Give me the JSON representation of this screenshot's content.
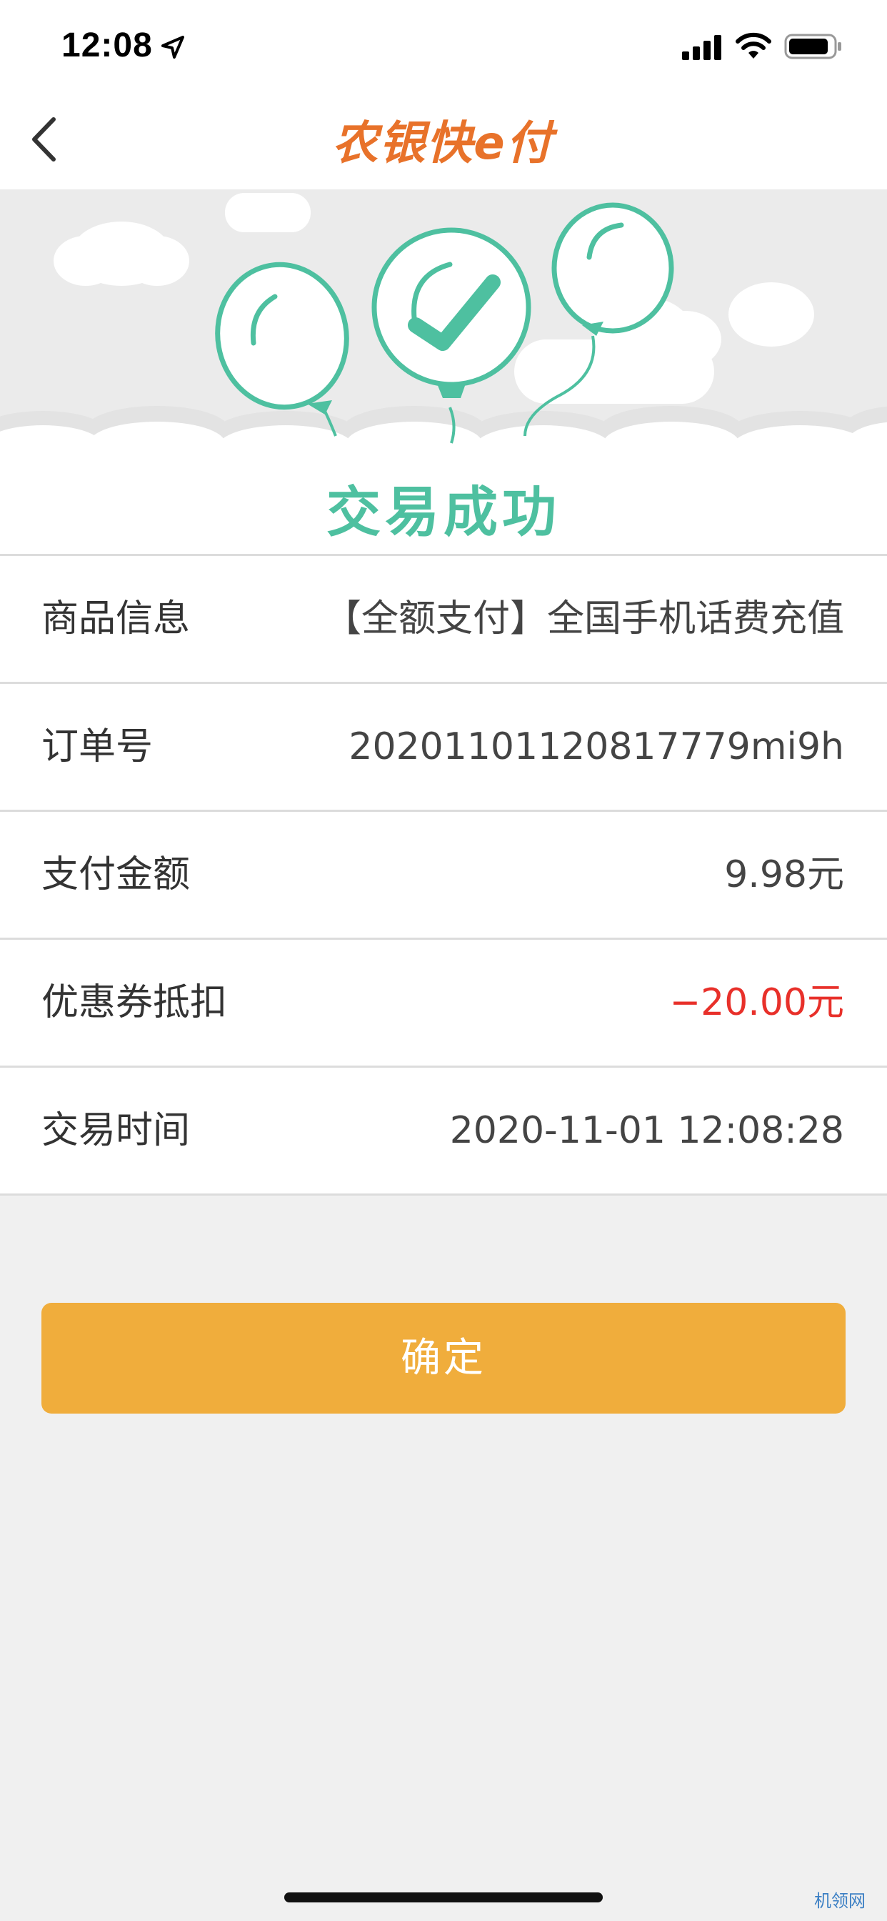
{
  "status_bar": {
    "time": "12:08",
    "icons": [
      "location-arrow-icon",
      "cellular-signal-icon",
      "wifi-icon",
      "battery-icon"
    ]
  },
  "nav": {
    "back_icon": "chevron-left-icon",
    "logo_text": "农银快e付"
  },
  "hero": {
    "title": "交易成功",
    "accent_color": "#4ec0a0"
  },
  "details": [
    {
      "label": "商品信息",
      "value": "【全额支付】全国手机话费充值"
    },
    {
      "label": "订单号",
      "value": "20201101120817779mi9h"
    },
    {
      "label": "支付金额",
      "value": "9.98元"
    },
    {
      "label": "优惠券抵扣",
      "value": "−20.00元",
      "value_color": "#e8302a"
    },
    {
      "label": "交易时间",
      "value": "2020-11-01 12:08:28"
    }
  ],
  "confirm_button": {
    "label": "确定",
    "color": "#f0ad3c"
  },
  "watermark": "机领网"
}
